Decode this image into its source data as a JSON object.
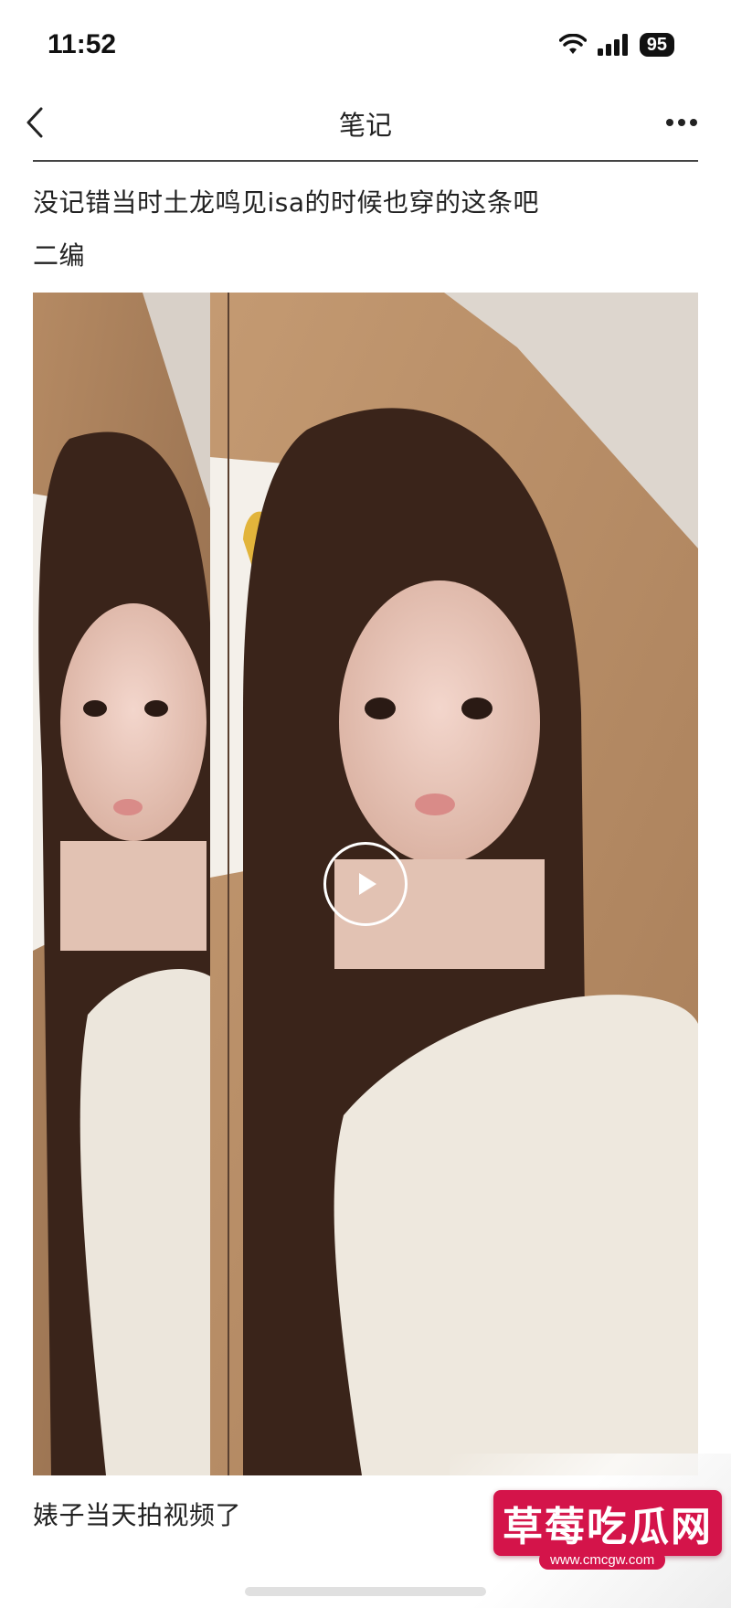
{
  "status_bar": {
    "time": "11:52",
    "battery": "95",
    "icons": [
      "wifi-icon",
      "signal-icon",
      "battery-icon"
    ]
  },
  "nav": {
    "title": "笔记",
    "back_icon": "chevron-left-icon",
    "more_icon": "more-dots-icon"
  },
  "post": {
    "line1": "没记错当时土龙鸣见isa的时候也穿的这条吧",
    "line2": "二编",
    "caption": "婊子当天拍视频了"
  },
  "video": {
    "play_icon": "play-icon"
  },
  "watermark": {
    "title": "草莓吃瓜网",
    "url": "www.cmcgw.com"
  },
  "colors": {
    "accent": "#d4144a",
    "text": "#222222",
    "background": "#ffffff"
  }
}
